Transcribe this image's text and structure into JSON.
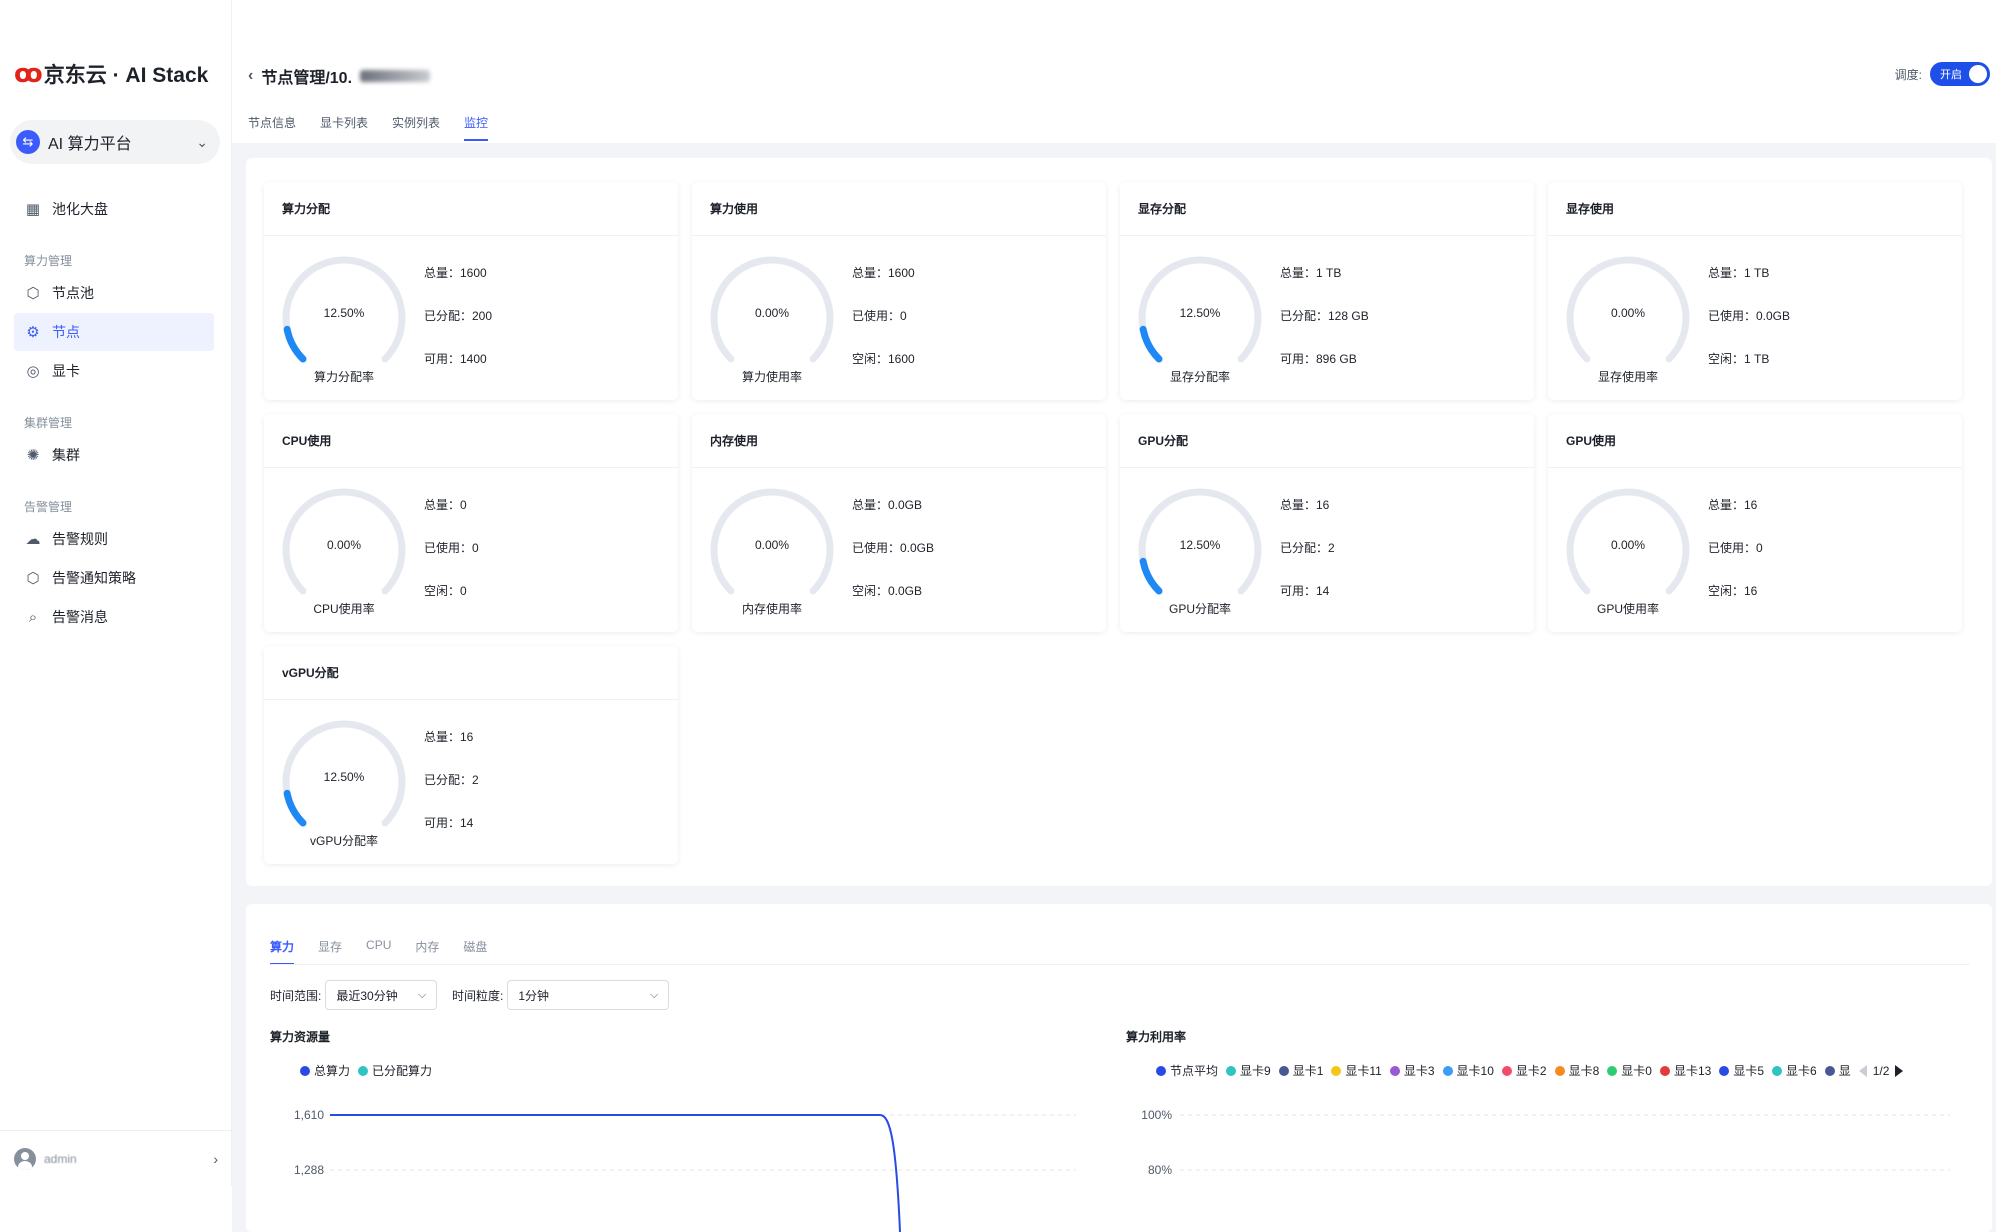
{
  "brand": {
    "logo_mark": "ꝏ",
    "name": "京东云 · AI Stack"
  },
  "platform_switch": {
    "label": "AI 算力平台",
    "icon": "swap-icon"
  },
  "sidebar": {
    "dashboard": "池化大盘",
    "groups": [
      {
        "title": "算力管理",
        "items": [
          "节点池",
          "节点",
          "显卡"
        ]
      },
      {
        "title": "集群管理",
        "items": [
          "集群"
        ]
      },
      {
        "title": "告警管理",
        "items": [
          "告警规则",
          "告警通知策略",
          "告警消息"
        ]
      }
    ]
  },
  "user": {
    "name": "admin"
  },
  "header": {
    "back_icon": "chevron-left-icon",
    "title": "节点管理/10."
  },
  "schedule": {
    "label": "调度:",
    "state": "开启"
  },
  "top_tabs": [
    "节点信息",
    "显卡列表",
    "实例列表",
    "监控"
  ],
  "cards": [
    {
      "title": "算力分配",
      "value": "12.50%",
      "pct": 0.125,
      "label": "算力分配率",
      "stats": [
        "总量：1600",
        "已分配：200",
        "可用：1400"
      ]
    },
    {
      "title": "算力使用",
      "value": "0.00%",
      "pct": 0,
      "label": "算力使用率",
      "stats": [
        "总量：1600",
        "已使用：0",
        "空闲：1600"
      ]
    },
    {
      "title": "显存分配",
      "value": "12.50%",
      "pct": 0.125,
      "label": "显存分配率",
      "stats": [
        "总量：1 TB",
        "已分配：128 GB",
        "可用：896 GB"
      ]
    },
    {
      "title": "显存使用",
      "value": "0.00%",
      "pct": 0,
      "label": "显存使用率",
      "stats": [
        "总量：1 TB",
        "已使用：0.0GB",
        "空闲：1 TB"
      ]
    },
    {
      "title": "CPU使用",
      "value": "0.00%",
      "pct": 0,
      "label": "CPU使用率",
      "stats": [
        "总量：0",
        "已使用：0",
        "空闲：0"
      ]
    },
    {
      "title": "内存使用",
      "value": "0.00%",
      "pct": 0,
      "label": "内存使用率",
      "stats": [
        "总量：0.0GB",
        "已使用：0.0GB",
        "空闲：0.0GB"
      ]
    },
    {
      "title": "GPU分配",
      "value": "12.50%",
      "pct": 0.125,
      "label": "GPU分配率",
      "stats": [
        "总量：16",
        "已分配：2",
        "可用：14"
      ]
    },
    {
      "title": "GPU使用",
      "value": "0.00%",
      "pct": 0,
      "label": "GPU使用率",
      "stats": [
        "总量：16",
        "已使用：0",
        "空闲：16"
      ]
    },
    {
      "title": "vGPU分配",
      "value": "12.50%",
      "pct": 0.125,
      "label": "vGPU分配率",
      "stats": [
        "总量：16",
        "已分配：2",
        "可用：14"
      ]
    }
  ],
  "bottom": {
    "tabs": [
      "算力",
      "显存",
      "CPU",
      "内存",
      "磁盘"
    ],
    "time_range": {
      "label": "时间范围:",
      "value": "最近30分钟"
    },
    "granularity": {
      "label": "时间粒度:",
      "value": "1分钟"
    }
  },
  "colors": {
    "accent": "#3b5bfd",
    "gauge_fill": "#1e88f5",
    "gauge_track": "#e5e8ef"
  },
  "chart_data": [
    {
      "type": "line",
      "title": "算力资源量",
      "series": [
        {
          "name": "总算力",
          "color": "#2a4ae6"
        },
        {
          "name": "已分配算力",
          "color": "#2fc4bf"
        }
      ],
      "y_ticks": [
        "1,610",
        "1,288"
      ],
      "total_line_value": 1610
    },
    {
      "type": "line",
      "title": "算力利用率",
      "legend": [
        {
          "name": "节点平均",
          "color": "#2a4ae6"
        },
        {
          "name": "显卡9",
          "color": "#2fc4bf"
        },
        {
          "name": "显卡1",
          "color": "#4a5795"
        },
        {
          "name": "显卡11",
          "color": "#f5c518"
        },
        {
          "name": "显卡3",
          "color": "#9b59d0"
        },
        {
          "name": "显卡10",
          "color": "#3c9ef5"
        },
        {
          "name": "显卡2",
          "color": "#f24c6a"
        },
        {
          "name": "显卡8",
          "color": "#f58a1f"
        },
        {
          "name": "显卡0",
          "color": "#2ecc71"
        },
        {
          "name": "显卡13",
          "color": "#e23b3b"
        },
        {
          "name": "显卡5",
          "color": "#2a4ae6"
        },
        {
          "name": "显卡6",
          "color": "#2fc4bf"
        },
        {
          "name": "显",
          "color": "#4a5795"
        }
      ],
      "page": "1/2",
      "y_ticks": [
        "100%",
        "80%"
      ]
    }
  ]
}
